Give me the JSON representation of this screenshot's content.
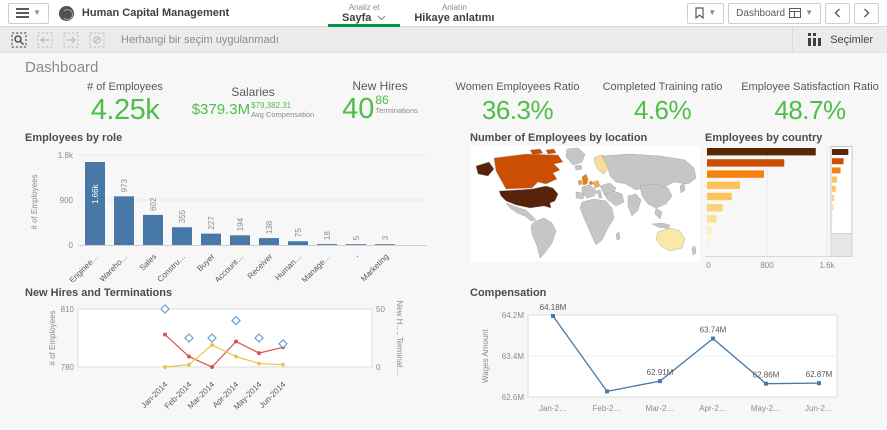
{
  "topbar": {
    "app_title": "Human Capital Management",
    "tabs": [
      {
        "super": "Analiz et",
        "label": "Sayfa",
        "active": true
      },
      {
        "super": "Anlatın",
        "label": "Hikaye anlatımı",
        "active": false
      }
    ],
    "sheet_label": "Dashboard"
  },
  "toolbar": {
    "message": "Herhangi bir seçim uygulanmadı",
    "selections_label": "Seçimler"
  },
  "page": {
    "title": "Dashboard"
  },
  "colors": {
    "kpi_green": "#4fbd49",
    "accent_green": "#009845",
    "bar_blue": "#4878a8"
  },
  "kpis": [
    {
      "label": "# of Employees",
      "value": "4.25k"
    },
    {
      "label": "Salaries",
      "value": "$379.3M",
      "sub_value": "$79,382.31",
      "sub_label": "Avg Compensation"
    },
    {
      "label": "New Hires",
      "value": "40",
      "sub_value": "86",
      "sub_label": "Terminations"
    },
    {
      "label": "Women Employees Ratio",
      "value": "36.3%"
    },
    {
      "label": "Completed Training ratio",
      "value": "4.6%"
    },
    {
      "label": "Employee Satisfaction Ratio",
      "value": "48.7%"
    }
  ],
  "chart_data": [
    {
      "id": "employees-by-role",
      "type": "bar",
      "title": "Employees by role",
      "ylabel": "# of Employees",
      "ylim": [
        0,
        1800
      ],
      "yticks": [
        {
          "value": 0,
          "label": "0"
        },
        {
          "value": 900,
          "label": "900"
        },
        {
          "value": 1800,
          "label": "1.8k"
        }
      ],
      "categories": [
        "Enginee…",
        "Wareho…",
        "Sales",
        "Constru…",
        "Buyer",
        "Account…",
        "Receiver",
        "Human…",
        "Manage…",
        "-",
        "Marketing"
      ],
      "values": [
        1660,
        973,
        602,
        355,
        227,
        194,
        138,
        75,
        18,
        5,
        3
      ],
      "value_labels": [
        "1.66k",
        "973",
        "602",
        "355",
        "227",
        "194",
        "138",
        "75",
        "18",
        "5",
        "3"
      ],
      "bar_color": "#4878a8",
      "grid": true
    },
    {
      "id": "employees-by-location",
      "type": "choropleth",
      "title": "Number of Employees by location",
      "region_colors": {
        "united_states": "#59220a",
        "alaska": "#59220a",
        "canada": "#cc4e02",
        "united_kingdom": "#e8820e",
        "ireland": "#f0a030",
        "benelux": "#e8820e",
        "germany": "#f5ae3d",
        "scandinavia": "#f9dd9a",
        "australia": "#fae8a8",
        "other_land": "#c6c6c6"
      }
    },
    {
      "id": "employees-by-country",
      "type": "bar-horizontal",
      "title": "Employees by country",
      "xlim": [
        0,
        1700
      ],
      "xticks": [
        {
          "value": 0,
          "label": "0"
        },
        {
          "value": 800,
          "label": "800"
        },
        {
          "value": 1600,
          "label": "1.6k"
        }
      ],
      "values": [
        1450,
        1030,
        760,
        440,
        330,
        210,
        130,
        60,
        45
      ],
      "colors": [
        "#5b2606",
        "#cc4e02",
        "#f5820e",
        "#fdc158",
        "#fcc35d",
        "#fbd27c",
        "#fce09a",
        "#fdecbc",
        "#fdf3d6"
      ],
      "has_scroll_minimap": true
    },
    {
      "id": "new-hires-and-terminations",
      "type": "line",
      "title": "New Hires and Terminations",
      "categories": [
        "Jan-2014",
        "Feb-2014",
        "Mar-2014",
        "Apr-2014",
        "May-2014",
        "Jun-2014"
      ],
      "left_axis": {
        "label": "# of Employees",
        "range": [
          780,
          810
        ],
        "ticks": [
          {
            "value": 780,
            "label": "780"
          },
          {
            "value": 810,
            "label": "810"
          }
        ]
      },
      "right_axis": {
        "label": "New H…, Terminat…",
        "range": [
          0,
          50
        ],
        "ticks": [
          {
            "value": 0,
            "label": "0"
          },
          {
            "value": 50,
            "label": "50"
          }
        ]
      },
      "series": [
        {
          "name": "# of Employees",
          "axis": "left",
          "style": "diamond-markers",
          "color": "#6a9fd8",
          "values": [
            810,
            795,
            795,
            804,
            795,
            792
          ]
        },
        {
          "name": "Terminations",
          "axis": "right",
          "style": "line-dots",
          "color": "#e0504e",
          "values": [
            28,
            9,
            0,
            22,
            12,
            17
          ]
        },
        {
          "name": "New Hires",
          "axis": "right",
          "style": "line-dots",
          "color": "#e3c74f",
          "values": [
            0,
            2,
            19,
            9,
            3,
            2
          ]
        }
      ]
    },
    {
      "id": "compensation",
      "type": "line",
      "title": "Compensation",
      "ylabel": "Wages Amount",
      "ylim": [
        62.6,
        64.2
      ],
      "yticks": [
        {
          "value": 62.6,
          "label": "62.6M"
        },
        {
          "value": 63.4,
          "label": "63.4M"
        },
        {
          "value": 64.2,
          "label": "64.2M"
        }
      ],
      "categories": [
        "Jan-2…",
        "Feb-2…",
        "Mar-2…",
        "Apr-2…",
        "May-2…",
        "Jun-2…"
      ],
      "values": [
        64.18,
        62.71,
        62.91,
        63.74,
        62.86,
        62.87
      ],
      "point_labels": [
        "64.18M",
        null,
        "62.91M",
        "63.74M",
        "62.86M",
        "62.87M"
      ],
      "line_color": "#4878a8"
    }
  ]
}
